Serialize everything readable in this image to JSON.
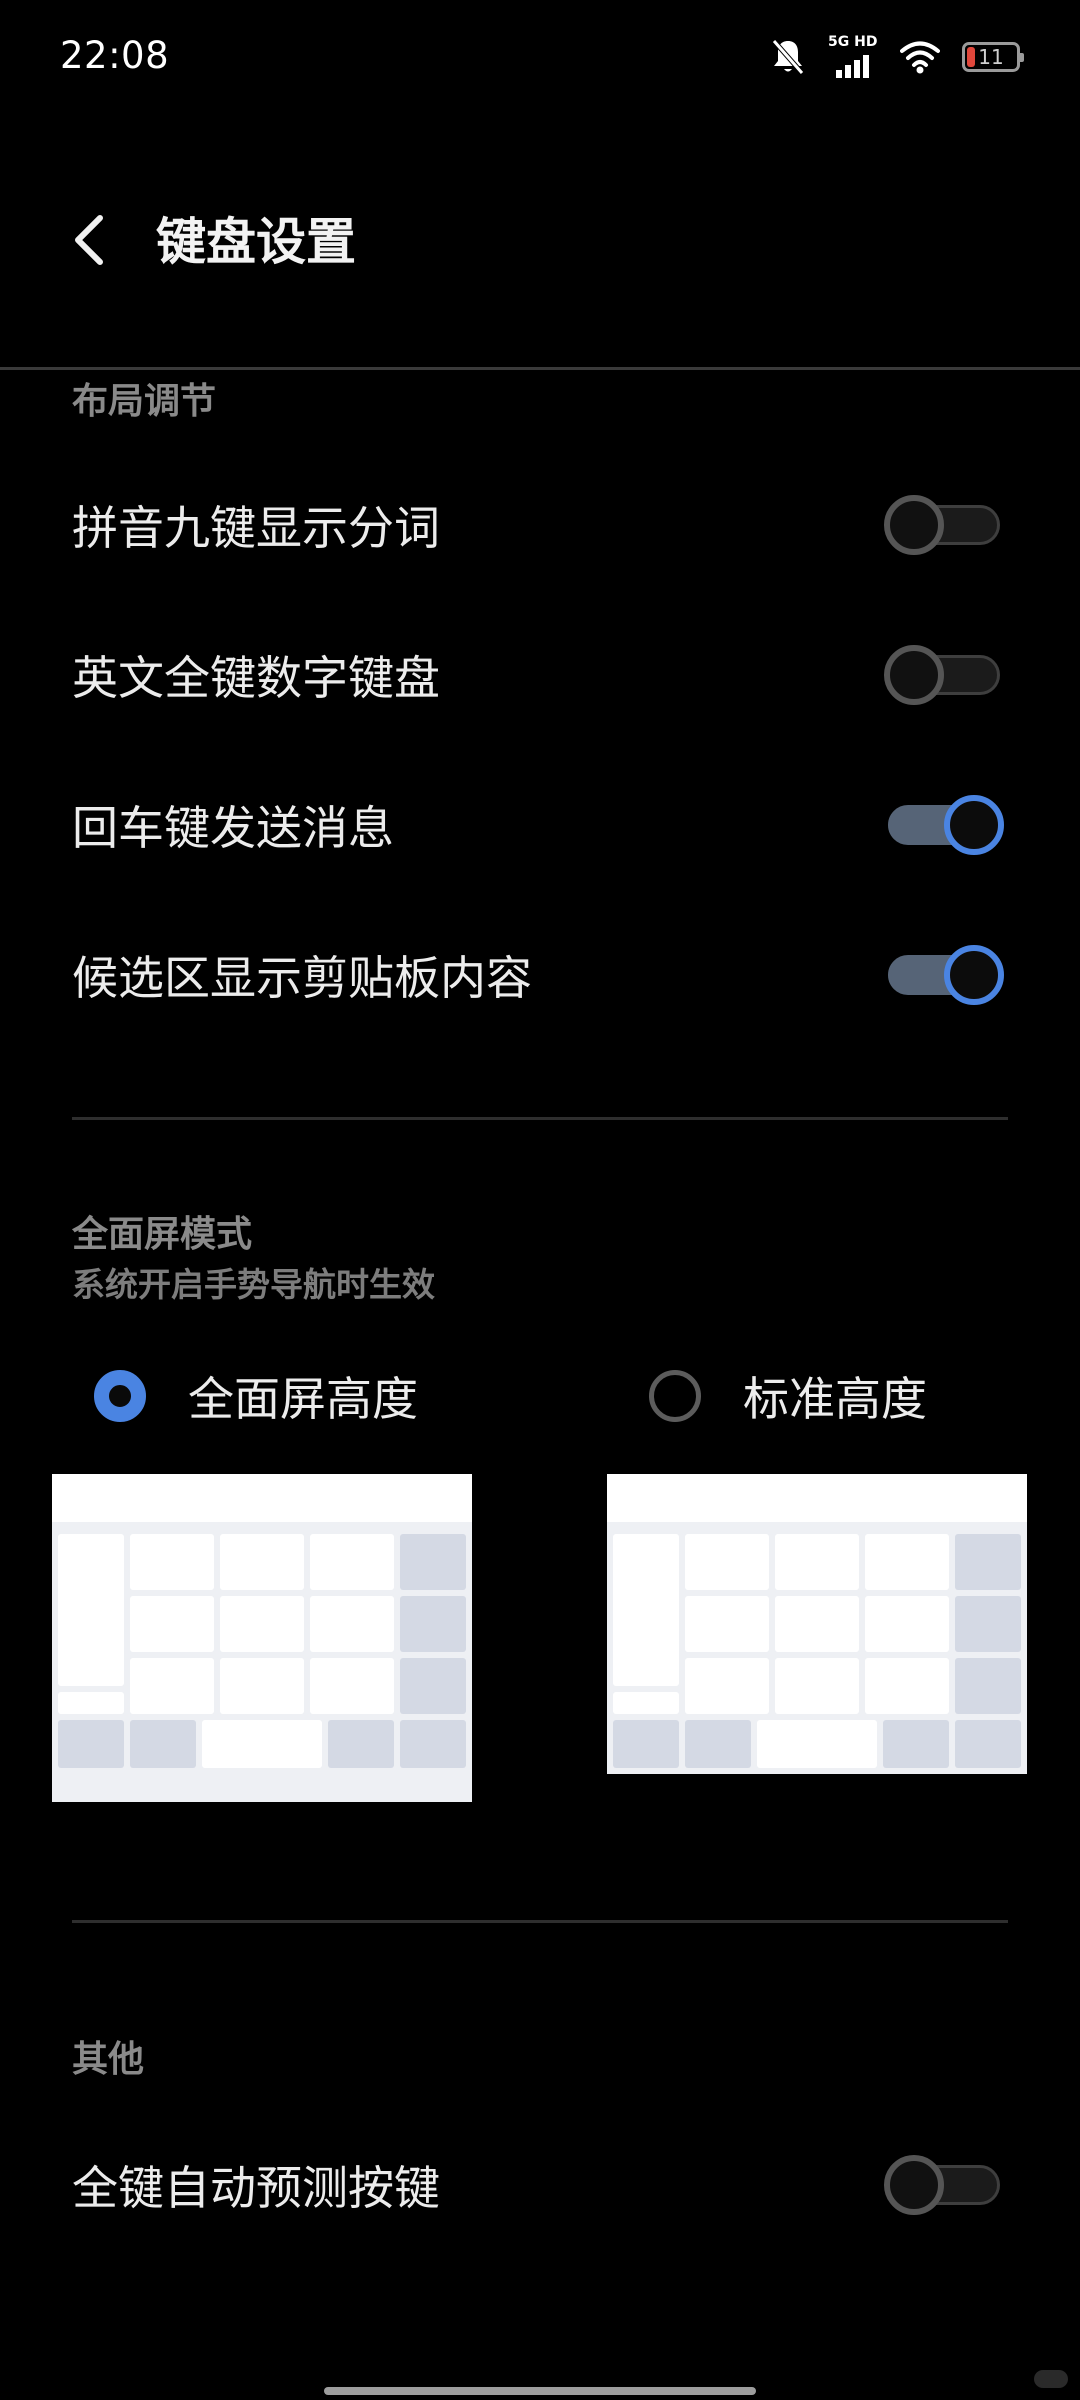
{
  "status_bar": {
    "time": "22:08",
    "network_label": "5G HD",
    "battery_level": "11",
    "icons": [
      "bell-muted-icon",
      "cellular-signal-icon",
      "wifi-icon",
      "battery-icon"
    ]
  },
  "header": {
    "title": "键盘设置",
    "back_icon": "chevron-left-icon"
  },
  "layout_section": {
    "title": "布局调节",
    "items": [
      {
        "label": "拼音九键显示分词",
        "enabled": false
      },
      {
        "label": "英文全键数字键盘",
        "enabled": false
      },
      {
        "label": "回车键发送消息",
        "enabled": true
      },
      {
        "label": "候选区显示剪贴板内容",
        "enabled": true
      }
    ]
  },
  "fullscreen_section": {
    "title": "全面屏模式",
    "subtitle": "系统开启手势导航时生效",
    "options": [
      {
        "label": "全面屏高度",
        "selected": true
      },
      {
        "label": "标准高度",
        "selected": false
      }
    ]
  },
  "other_section": {
    "title": "其他",
    "items": [
      {
        "label": "全键自动预测按键",
        "enabled": false
      }
    ]
  },
  "colors": {
    "accent": "#4a84e2",
    "background": "#000000",
    "switch_on_track": "#566477",
    "section_header": "#8a8a8a"
  }
}
